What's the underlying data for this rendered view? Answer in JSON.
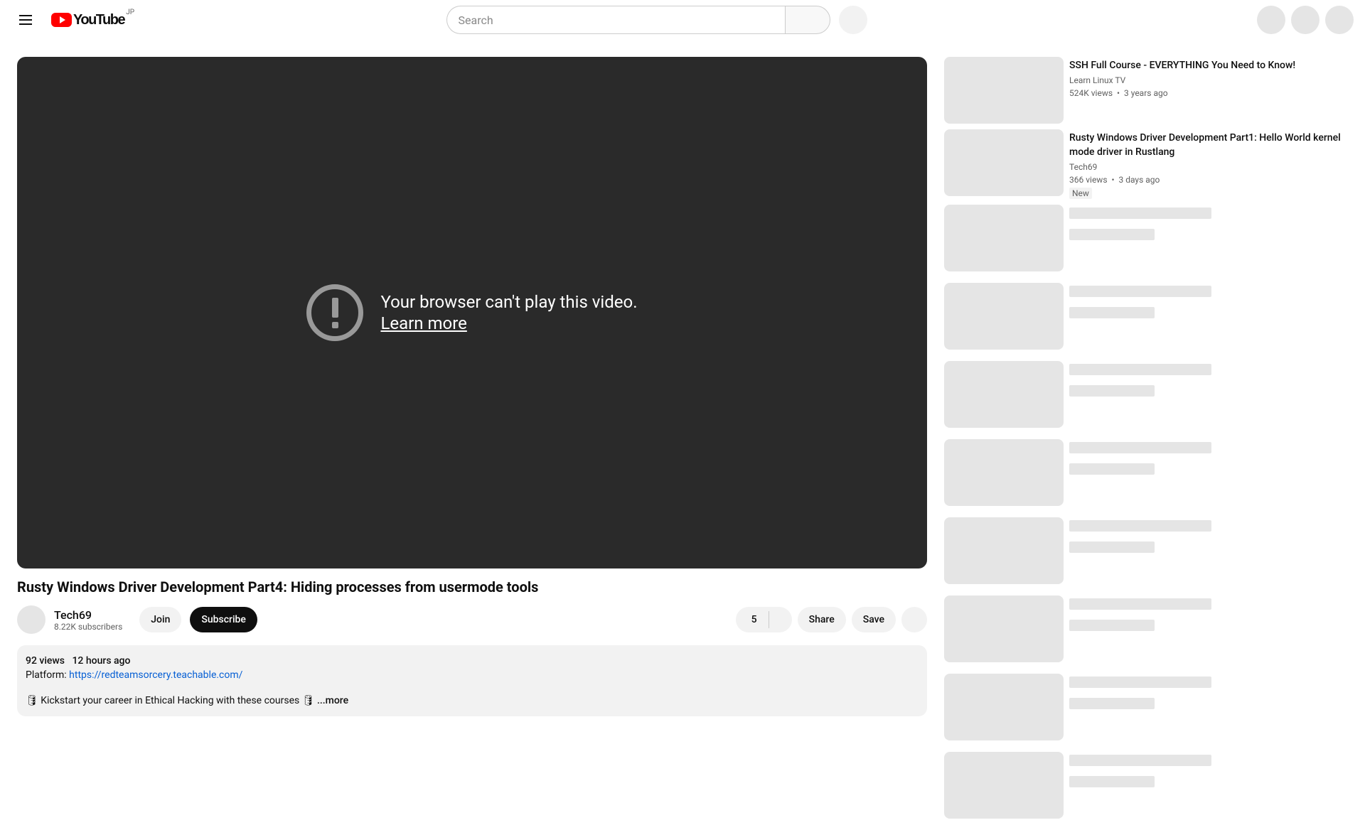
{
  "header": {
    "logo_text": "YouTube",
    "country_code": "JP",
    "search_placeholder": "Search"
  },
  "player": {
    "error_msg": "Your browser can't play this video.",
    "learn_more": "Learn more"
  },
  "video": {
    "title": "Rusty Windows Driver Development Part4: Hiding processes from usermode tools"
  },
  "channel": {
    "name": "Tech69",
    "subscribers": "8.22K subscribers",
    "join_label": "Join",
    "subscribe_label": "Subscribe"
  },
  "actions": {
    "like_count": "5",
    "share_label": "Share",
    "save_label": "Save"
  },
  "description": {
    "views": "92 views",
    "age": "12 hours ago",
    "platform_label": "Platform: ",
    "platform_url": "https://redteamsorcery.teachable.com/",
    "body_line": "🛢 Kickstart your career in Ethical Hacking with these courses 🛢 ",
    "more_label": "...more"
  },
  "recommendations": [
    {
      "title": "SSH Full Course - EVERYTHING You Need to Know!",
      "channel": "Learn Linux TV",
      "views": "524K views",
      "age": "3 years ago",
      "badge": ""
    },
    {
      "title": "Rusty Windows Driver Development Part1: Hello World kernel mode driver in Rustlang",
      "channel": "Tech69",
      "views": "366 views",
      "age": "3 days ago",
      "badge": "New"
    }
  ]
}
